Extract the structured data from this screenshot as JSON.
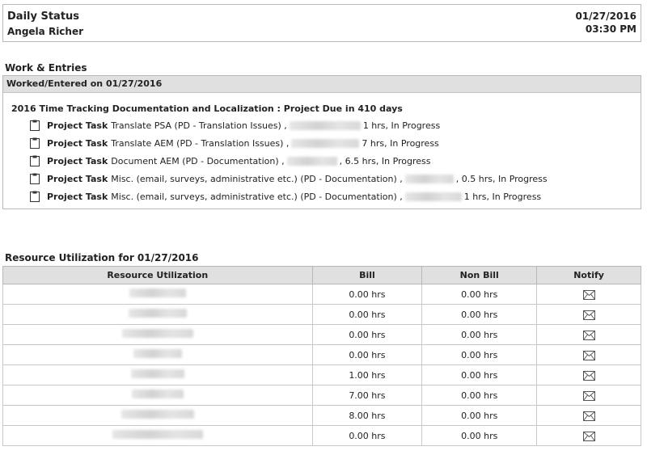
{
  "header": {
    "title": "Daily Status",
    "user": "Angela Richer",
    "date": "01/27/2016",
    "time": "03:30 PM"
  },
  "work": {
    "section_title": "Work & Entries",
    "bar_label": "Worked/Entered on 01/27/2016",
    "project_title": "2016 Time Tracking Documentation and Localization : Project Due in 410 days",
    "tasks": [
      {
        "kind": "Project Task",
        "desc": "Translate PSA (PD - Translation Issues) ,",
        "suffix": "1 hrs, In Progress",
        "icon": "clipboard-icon"
      },
      {
        "kind": "Project Task",
        "desc": "Translate AEM (PD - Translation Issues) ,",
        "suffix": "7 hrs, In Progress",
        "icon": "clipboard-icon"
      },
      {
        "kind": "Project Task",
        "desc": "Document AEM (PD - Documentation) ,",
        "suffix": ", 6.5 hrs, In Progress",
        "icon": "clipboard-icon"
      },
      {
        "kind": "Project Task",
        "desc": "Misc. (email, surveys, administrative etc.) (PD - Documentation) ,",
        "suffix": ", 0.5 hrs, In Progress",
        "icon": "clipboard-icon"
      },
      {
        "kind": "Project Task",
        "desc": "Misc. (email, surveys, administrative etc.) (PD - Documentation) ,",
        "suffix": "1 hrs, In Progress",
        "icon": "clipboard-icon"
      }
    ]
  },
  "utilization": {
    "section_title": "Resource Utilization  for 01/27/2016",
    "columns": [
      "Resource Utilization",
      "Bill",
      "Non Bill",
      "Notify"
    ],
    "rows": [
      {
        "bill": "0.00 hrs",
        "nonbill": "0.00 hrs"
      },
      {
        "bill": "0.00 hrs",
        "nonbill": "0.00 hrs"
      },
      {
        "bill": "0.00 hrs",
        "nonbill": "0.00 hrs"
      },
      {
        "bill": "0.00 hrs",
        "nonbill": "0.00 hrs"
      },
      {
        "bill": "1.00 hrs",
        "nonbill": "0.00 hrs"
      },
      {
        "bill": "7.00 hrs",
        "nonbill": "0.00 hrs"
      },
      {
        "bill": "8.00 hrs",
        "nonbill": "0.00 hrs"
      },
      {
        "bill": "0.00 hrs",
        "nonbill": "0.00 hrs"
      }
    ],
    "notify_icon": "envelope-icon"
  }
}
